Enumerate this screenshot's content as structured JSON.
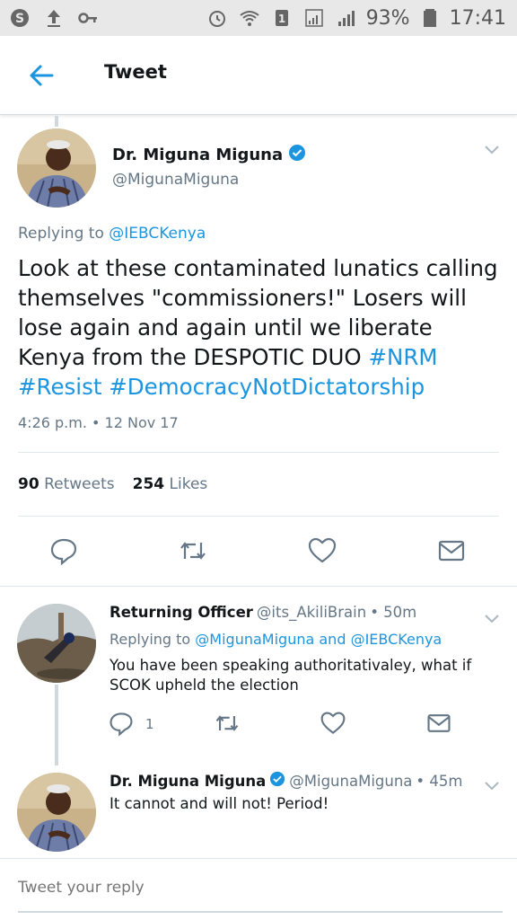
{
  "status_bar": {
    "left_icons": [
      "skype-icon",
      "upload-icon",
      "key-icon"
    ],
    "right_icons": [
      "alarm-icon",
      "wifi-icon",
      "sim-icon",
      "signal-icon",
      "signal-icon"
    ],
    "battery": "93%",
    "time": "17:41"
  },
  "header": {
    "title": "Tweet"
  },
  "main_tweet": {
    "name": "Dr. Miguna Miguna",
    "handle": "@MigunaMiguna",
    "replying_prefix": "Replying to",
    "replying_to": "@IEBCKenya",
    "text": "Look at these contaminated lunatics calling themselves \"commissioners!\" Losers will lose again and again until we liberate Kenya from the DESPOTIC DUO",
    "hashtags": [
      "#NRM",
      "#Resist",
      "#DemocracyNotDictatorship"
    ],
    "timestamp": "4:26 p.m. • 12 Nov 17",
    "retweets_count": "90",
    "retweets_label": "Retweets",
    "likes_count": "254",
    "likes_label": "Likes"
  },
  "replies": [
    {
      "name": "Returning Officer",
      "handle": "@its_AkiliBrain",
      "time": "• 50m",
      "replying_prefix": "Replying to",
      "replying_to_1": "@MigunaMiguna",
      "replying_and": "and",
      "replying_to_2": "@IEBCKenya",
      "text": "You have been speaking authoritativaley, what if SCOK upheld the election",
      "reply_count": "1"
    },
    {
      "name": "Dr. Miguna Miguna",
      "handle": "@MigunaMiguna",
      "time": "• 45m",
      "text": "It cannot and will not! Period!"
    }
  ],
  "composer": {
    "placeholder": "Tweet your reply"
  },
  "colors": {
    "accent": "#1b95e0",
    "muted": "#657786",
    "text": "#14171a",
    "divider": "#e1e8ed"
  }
}
